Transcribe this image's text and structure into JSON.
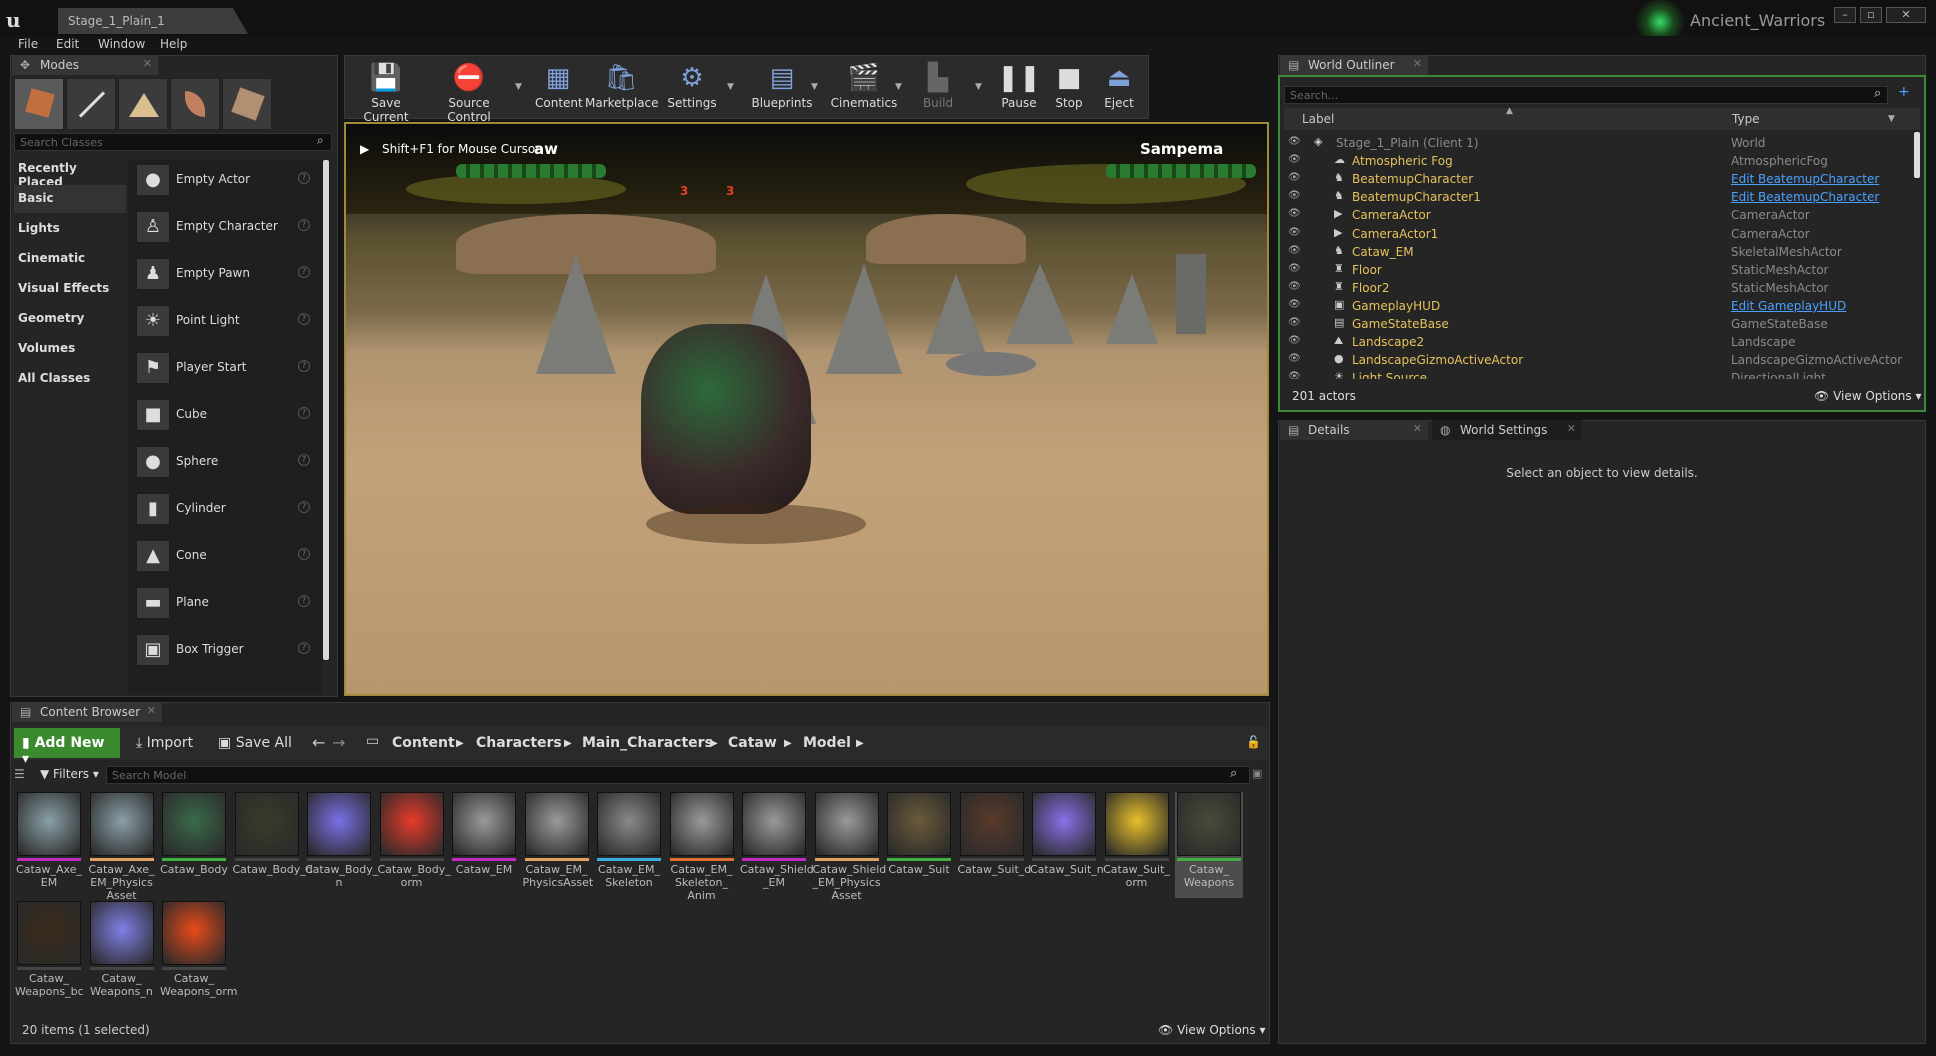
{
  "window": {
    "level_tab": "Stage_1_Plain_1",
    "project_name": "Ancient_Warriors",
    "minimize": "–",
    "maximize": "▫",
    "close": "✕"
  },
  "menu": [
    "File",
    "Edit",
    "Window",
    "Help"
  ],
  "modes": {
    "tab": "Modes",
    "search_placeholder": "Search Classes",
    "categories": [
      "Recently Placed",
      "Basic",
      "Lights",
      "Cinematic",
      "Visual Effects",
      "Geometry",
      "Volumes",
      "All Classes"
    ],
    "items": [
      "Empty Actor",
      "Empty Character",
      "Empty Pawn",
      "Point Light",
      "Player Start",
      "Cube",
      "Sphere",
      "Cylinder",
      "Cone",
      "Plane",
      "Box Trigger"
    ],
    "help": "?"
  },
  "toolbar": {
    "buttons": [
      "Save Current",
      "Source Control",
      "Content",
      "Marketplace",
      "Settings",
      "Blueprints",
      "Cinematics",
      "Build",
      "Pause",
      "Stop",
      "Eject"
    ]
  },
  "viewport": {
    "hint": "Shift+F1 for Mouse Cursor",
    "hud_left": "aw",
    "hud_right": "Sampema",
    "hud_num1": "3",
    "hud_num2": "3"
  },
  "outliner": {
    "tab": "World Outliner",
    "search_placeholder": "Search...",
    "col_label": "Label",
    "col_type": "Type",
    "rows": [
      {
        "label": "Stage_1_Plain (Client 1)",
        "type": "World"
      },
      {
        "label": "Atmospheric Fog",
        "type": "AtmosphericFog"
      },
      {
        "label": "BeatemupCharacter",
        "type": "Edit BeatemupCharacter"
      },
      {
        "label": "BeatemupCharacter1",
        "type": "Edit BeatemupCharacter"
      },
      {
        "label": "CameraActor",
        "type": "CameraActor"
      },
      {
        "label": "CameraActor1",
        "type": "CameraActor"
      },
      {
        "label": "Cataw_EM",
        "type": "SkeletalMeshActor"
      },
      {
        "label": "Floor",
        "type": "StaticMeshActor"
      },
      {
        "label": "Floor2",
        "type": "StaticMeshActor"
      },
      {
        "label": "GameplayHUD",
        "type": "Edit GameplayHUD"
      },
      {
        "label": "GameStateBase",
        "type": "GameStateBase"
      },
      {
        "label": "Landscape2",
        "type": "Landscape"
      },
      {
        "label": "LandscapeGizmoActiveActor",
        "type": "LandscapeGizmoActiveActor"
      },
      {
        "label": "Light Source",
        "type": "DirectionalLight"
      }
    ],
    "count": "201 actors",
    "view_options": "View Options"
  },
  "details": {
    "tab1": "Details",
    "tab2": "World Settings",
    "empty_msg": "Select an object to view details."
  },
  "content_browser": {
    "tab": "Content Browser",
    "add_new": "Add New",
    "import": "Import",
    "save_all": "Save All",
    "path": [
      "Content",
      "Characters",
      "Main_Characters",
      "Cataw",
      "Model"
    ],
    "filters": "Filters",
    "search_placeholder": "Search Model",
    "assets": [
      {
        "name": "Cataw_Axe_EM",
        "bar": "#c02ac0",
        "img": "#8aa0a8"
      },
      {
        "name": "Cataw_Axe_EM_PhysicsAsset",
        "bar": "#e0a060",
        "img": "#8aa0a8"
      },
      {
        "name": "Cataw_Body",
        "bar": "#40b040",
        "img": "#3a6a4a"
      },
      {
        "name": "Cataw_Body_d",
        "bar": "#444",
        "img": "#3a3a2a"
      },
      {
        "name": "Cataw_Body_n",
        "bar": "#444",
        "img": "#7a70e8"
      },
      {
        "name": "Cataw_Body_orm",
        "bar": "#444",
        "img": "#e83a2a"
      },
      {
        "name": "Cataw_EM",
        "bar": "#c02ac0",
        "img": "#9a9a9a"
      },
      {
        "name": "Cataw_EM_PhysicsAsset",
        "bar": "#e0a060",
        "img": "#9a9a9a"
      },
      {
        "name": "Cataw_EM_Skeleton",
        "bar": "#3ab0e0",
        "img": "#8a8a8a"
      },
      {
        "name": "Cataw_EM_Skeleton_Anim",
        "bar": "#e07030",
        "img": "#9a9a9a"
      },
      {
        "name": "Cataw_Shield_EM",
        "bar": "#c02ac0",
        "img": "#9a9a9a"
      },
      {
        "name": "Cataw_Shield_EM_PhysicsAsset",
        "bar": "#e0a060",
        "img": "#9a9a9a"
      },
      {
        "name": "Cataw_Suit",
        "bar": "#40b040",
        "img": "#6a5a3a"
      },
      {
        "name": "Cataw_Suit_d",
        "bar": "#444",
        "img": "#5a3a2a"
      },
      {
        "name": "Cataw_Suit_n",
        "bar": "#444",
        "img": "#8a70e8"
      },
      {
        "name": "Cataw_Suit_orm",
        "bar": "#444",
        "img": "#e8c02a"
      },
      {
        "name": "Cataw_Weapons",
        "bar": "#40b040",
        "img": "#4a4a3a"
      },
      {
        "name": "Cataw_Weapons_bc",
        "bar": "#444",
        "img": "#3a2a1a"
      },
      {
        "name": "Cataw_Weapons_n",
        "bar": "#444",
        "img": "#8080e8"
      },
      {
        "name": "Cataw_Weapons_orm",
        "bar": "#444",
        "img": "#e84a1a"
      }
    ],
    "asset_labels": [
      "Cataw_Axe_\nEM",
      "Cataw_Axe_\nEM_Physics\nAsset",
      "Cataw_Body",
      "Cataw_Body_d",
      "Cataw_Body_\nn",
      "Cataw_Body_\norm",
      "Cataw_EM",
      "Cataw_EM_\nPhysicsAsset",
      "Cataw_EM_\nSkeleton",
      "Cataw_EM_\nSkeleton_\nAnim",
      "Cataw_Shield\n_EM",
      "Cataw_Shield\n_EM_Physics\nAsset",
      "Cataw_Suit",
      "Cataw_Suit_d",
      "Cataw_Suit_n",
      "Cataw_Suit_\norm",
      "Cataw_\nWeapons",
      "Cataw_\nWeapons_bc",
      "Cataw_\nWeapons_n",
      "Cataw_\nWeapons_orm"
    ],
    "status": "20 items (1 selected)",
    "view_options": "View Options"
  }
}
